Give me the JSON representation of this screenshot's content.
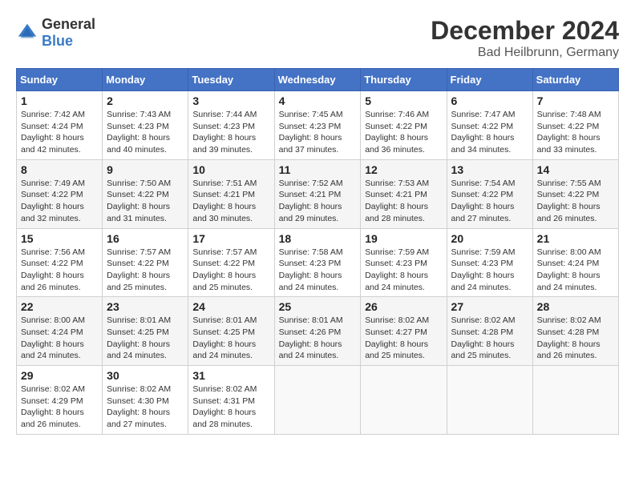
{
  "header": {
    "logo": {
      "general": "General",
      "blue": "Blue"
    },
    "title": "December 2024",
    "subtitle": "Bad Heilbrunn, Germany"
  },
  "calendar": {
    "days_of_week": [
      "Sunday",
      "Monday",
      "Tuesday",
      "Wednesday",
      "Thursday",
      "Friday",
      "Saturday"
    ],
    "weeks": [
      [
        {
          "day": "1",
          "sunrise": "Sunrise: 7:42 AM",
          "sunset": "Sunset: 4:24 PM",
          "daylight": "Daylight: 8 hours and 42 minutes."
        },
        {
          "day": "2",
          "sunrise": "Sunrise: 7:43 AM",
          "sunset": "Sunset: 4:23 PM",
          "daylight": "Daylight: 8 hours and 40 minutes."
        },
        {
          "day": "3",
          "sunrise": "Sunrise: 7:44 AM",
          "sunset": "Sunset: 4:23 PM",
          "daylight": "Daylight: 8 hours and 39 minutes."
        },
        {
          "day": "4",
          "sunrise": "Sunrise: 7:45 AM",
          "sunset": "Sunset: 4:23 PM",
          "daylight": "Daylight: 8 hours and 37 minutes."
        },
        {
          "day": "5",
          "sunrise": "Sunrise: 7:46 AM",
          "sunset": "Sunset: 4:22 PM",
          "daylight": "Daylight: 8 hours and 36 minutes."
        },
        {
          "day": "6",
          "sunrise": "Sunrise: 7:47 AM",
          "sunset": "Sunset: 4:22 PM",
          "daylight": "Daylight: 8 hours and 34 minutes."
        },
        {
          "day": "7",
          "sunrise": "Sunrise: 7:48 AM",
          "sunset": "Sunset: 4:22 PM",
          "daylight": "Daylight: 8 hours and 33 minutes."
        }
      ],
      [
        {
          "day": "8",
          "sunrise": "Sunrise: 7:49 AM",
          "sunset": "Sunset: 4:22 PM",
          "daylight": "Daylight: 8 hours and 32 minutes."
        },
        {
          "day": "9",
          "sunrise": "Sunrise: 7:50 AM",
          "sunset": "Sunset: 4:22 PM",
          "daylight": "Daylight: 8 hours and 31 minutes."
        },
        {
          "day": "10",
          "sunrise": "Sunrise: 7:51 AM",
          "sunset": "Sunset: 4:21 PM",
          "daylight": "Daylight: 8 hours and 30 minutes."
        },
        {
          "day": "11",
          "sunrise": "Sunrise: 7:52 AM",
          "sunset": "Sunset: 4:21 PM",
          "daylight": "Daylight: 8 hours and 29 minutes."
        },
        {
          "day": "12",
          "sunrise": "Sunrise: 7:53 AM",
          "sunset": "Sunset: 4:21 PM",
          "daylight": "Daylight: 8 hours and 28 minutes."
        },
        {
          "day": "13",
          "sunrise": "Sunrise: 7:54 AM",
          "sunset": "Sunset: 4:22 PM",
          "daylight": "Daylight: 8 hours and 27 minutes."
        },
        {
          "day": "14",
          "sunrise": "Sunrise: 7:55 AM",
          "sunset": "Sunset: 4:22 PM",
          "daylight": "Daylight: 8 hours and 26 minutes."
        }
      ],
      [
        {
          "day": "15",
          "sunrise": "Sunrise: 7:56 AM",
          "sunset": "Sunset: 4:22 PM",
          "daylight": "Daylight: 8 hours and 26 minutes."
        },
        {
          "day": "16",
          "sunrise": "Sunrise: 7:57 AM",
          "sunset": "Sunset: 4:22 PM",
          "daylight": "Daylight: 8 hours and 25 minutes."
        },
        {
          "day": "17",
          "sunrise": "Sunrise: 7:57 AM",
          "sunset": "Sunset: 4:22 PM",
          "daylight": "Daylight: 8 hours and 25 minutes."
        },
        {
          "day": "18",
          "sunrise": "Sunrise: 7:58 AM",
          "sunset": "Sunset: 4:23 PM",
          "daylight": "Daylight: 8 hours and 24 minutes."
        },
        {
          "day": "19",
          "sunrise": "Sunrise: 7:59 AM",
          "sunset": "Sunset: 4:23 PM",
          "daylight": "Daylight: 8 hours and 24 minutes."
        },
        {
          "day": "20",
          "sunrise": "Sunrise: 7:59 AM",
          "sunset": "Sunset: 4:23 PM",
          "daylight": "Daylight: 8 hours and 24 minutes."
        },
        {
          "day": "21",
          "sunrise": "Sunrise: 8:00 AM",
          "sunset": "Sunset: 4:24 PM",
          "daylight": "Daylight: 8 hours and 24 minutes."
        }
      ],
      [
        {
          "day": "22",
          "sunrise": "Sunrise: 8:00 AM",
          "sunset": "Sunset: 4:24 PM",
          "daylight": "Daylight: 8 hours and 24 minutes."
        },
        {
          "day": "23",
          "sunrise": "Sunrise: 8:01 AM",
          "sunset": "Sunset: 4:25 PM",
          "daylight": "Daylight: 8 hours and 24 minutes."
        },
        {
          "day": "24",
          "sunrise": "Sunrise: 8:01 AM",
          "sunset": "Sunset: 4:25 PM",
          "daylight": "Daylight: 8 hours and 24 minutes."
        },
        {
          "day": "25",
          "sunrise": "Sunrise: 8:01 AM",
          "sunset": "Sunset: 4:26 PM",
          "daylight": "Daylight: 8 hours and 24 minutes."
        },
        {
          "day": "26",
          "sunrise": "Sunrise: 8:02 AM",
          "sunset": "Sunset: 4:27 PM",
          "daylight": "Daylight: 8 hours and 25 minutes."
        },
        {
          "day": "27",
          "sunrise": "Sunrise: 8:02 AM",
          "sunset": "Sunset: 4:28 PM",
          "daylight": "Daylight: 8 hours and 25 minutes."
        },
        {
          "day": "28",
          "sunrise": "Sunrise: 8:02 AM",
          "sunset": "Sunset: 4:28 PM",
          "daylight": "Daylight: 8 hours and 26 minutes."
        }
      ],
      [
        {
          "day": "29",
          "sunrise": "Sunrise: 8:02 AM",
          "sunset": "Sunset: 4:29 PM",
          "daylight": "Daylight: 8 hours and 26 minutes."
        },
        {
          "day": "30",
          "sunrise": "Sunrise: 8:02 AM",
          "sunset": "Sunset: 4:30 PM",
          "daylight": "Daylight: 8 hours and 27 minutes."
        },
        {
          "day": "31",
          "sunrise": "Sunrise: 8:02 AM",
          "sunset": "Sunset: 4:31 PM",
          "daylight": "Daylight: 8 hours and 28 minutes."
        },
        null,
        null,
        null,
        null
      ]
    ]
  }
}
